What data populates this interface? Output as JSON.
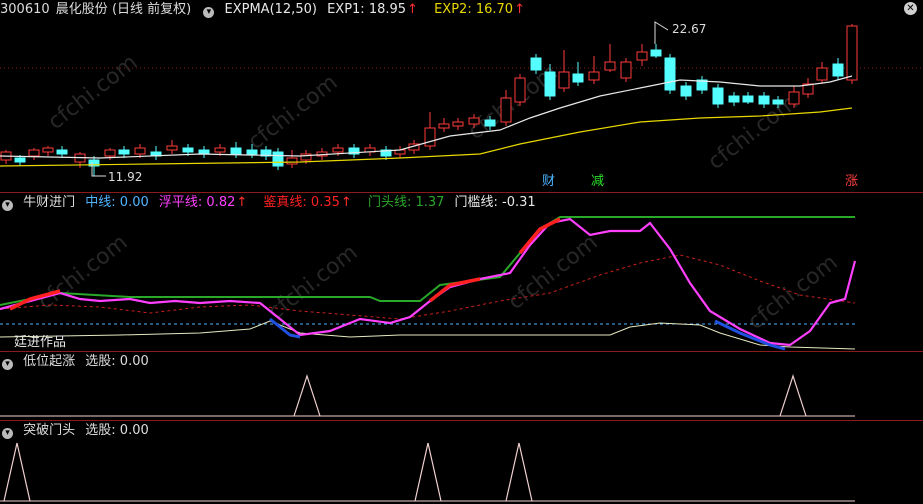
{
  "colors": {
    "up": "#ff3b3b",
    "down": "#54ffff",
    "exp1": "#e8e8e8",
    "exp2": "#e8d800",
    "grid": "#8b1a1a",
    "zhong": "#4fb4ff",
    "fuping": "#ff40ff",
    "jianzhen": "#ff2020",
    "mentou": "#2aa82a",
    "menlian": "#e8e8e8"
  },
  "panel1": {
    "code": "300610",
    "name": "晨化股份",
    "period": "(日线 前复权)",
    "indicator": "EXPMA(12,50)",
    "exp1_label": "EXP1: 18.95",
    "exp2_label": "EXP2: 16.70",
    "high_label": "22.67",
    "low_label": "11.92",
    "tags": [
      "财",
      "减",
      "涨"
    ]
  },
  "panel2": {
    "title": "牛财进门",
    "zhong": "中线: 0.00",
    "fuping": "浮平线: 0.82",
    "jianzhen": "鉴真线: 0.35",
    "mentou": "门头线: 1.37",
    "menlian": "门槛线: -0.31",
    "credit": "廷进作品"
  },
  "panel3": {
    "title": "低位起涨",
    "value": "选股: 0.00"
  },
  "panel4": {
    "title": "突破门头",
    "value": "选股: 0.00"
  },
  "watermark": "cfchi.com"
}
